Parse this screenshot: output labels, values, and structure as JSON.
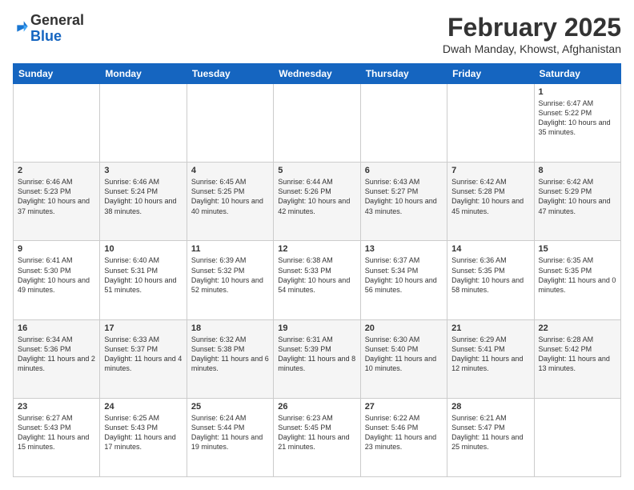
{
  "header": {
    "logo": {
      "general": "General",
      "blue": "Blue"
    },
    "title": "February 2025",
    "location": "Dwah Manday, Khowst, Afghanistan"
  },
  "days": [
    "Sunday",
    "Monday",
    "Tuesday",
    "Wednesday",
    "Thursday",
    "Friday",
    "Saturday"
  ],
  "weeks": [
    [
      {
        "num": "",
        "content": ""
      },
      {
        "num": "",
        "content": ""
      },
      {
        "num": "",
        "content": ""
      },
      {
        "num": "",
        "content": ""
      },
      {
        "num": "",
        "content": ""
      },
      {
        "num": "",
        "content": ""
      },
      {
        "num": "1",
        "content": "Sunrise: 6:47 AM\nSunset: 5:22 PM\nDaylight: 10 hours\nand 35 minutes."
      }
    ],
    [
      {
        "num": "2",
        "content": "Sunrise: 6:46 AM\nSunset: 5:23 PM\nDaylight: 10 hours\nand 37 minutes."
      },
      {
        "num": "3",
        "content": "Sunrise: 6:46 AM\nSunset: 5:24 PM\nDaylight: 10 hours\nand 38 minutes."
      },
      {
        "num": "4",
        "content": "Sunrise: 6:45 AM\nSunset: 5:25 PM\nDaylight: 10 hours\nand 40 minutes."
      },
      {
        "num": "5",
        "content": "Sunrise: 6:44 AM\nSunset: 5:26 PM\nDaylight: 10 hours\nand 42 minutes."
      },
      {
        "num": "6",
        "content": "Sunrise: 6:43 AM\nSunset: 5:27 PM\nDaylight: 10 hours\nand 43 minutes."
      },
      {
        "num": "7",
        "content": "Sunrise: 6:42 AM\nSunset: 5:28 PM\nDaylight: 10 hours\nand 45 minutes."
      },
      {
        "num": "8",
        "content": "Sunrise: 6:42 AM\nSunset: 5:29 PM\nDaylight: 10 hours\nand 47 minutes."
      }
    ],
    [
      {
        "num": "9",
        "content": "Sunrise: 6:41 AM\nSunset: 5:30 PM\nDaylight: 10 hours\nand 49 minutes."
      },
      {
        "num": "10",
        "content": "Sunrise: 6:40 AM\nSunset: 5:31 PM\nDaylight: 10 hours\nand 51 minutes."
      },
      {
        "num": "11",
        "content": "Sunrise: 6:39 AM\nSunset: 5:32 PM\nDaylight: 10 hours\nand 52 minutes."
      },
      {
        "num": "12",
        "content": "Sunrise: 6:38 AM\nSunset: 5:33 PM\nDaylight: 10 hours\nand 54 minutes."
      },
      {
        "num": "13",
        "content": "Sunrise: 6:37 AM\nSunset: 5:34 PM\nDaylight: 10 hours\nand 56 minutes."
      },
      {
        "num": "14",
        "content": "Sunrise: 6:36 AM\nSunset: 5:35 PM\nDaylight: 10 hours\nand 58 minutes."
      },
      {
        "num": "15",
        "content": "Sunrise: 6:35 AM\nSunset: 5:35 PM\nDaylight: 11 hours\nand 0 minutes."
      }
    ],
    [
      {
        "num": "16",
        "content": "Sunrise: 6:34 AM\nSunset: 5:36 PM\nDaylight: 11 hours\nand 2 minutes."
      },
      {
        "num": "17",
        "content": "Sunrise: 6:33 AM\nSunset: 5:37 PM\nDaylight: 11 hours\nand 4 minutes."
      },
      {
        "num": "18",
        "content": "Sunrise: 6:32 AM\nSunset: 5:38 PM\nDaylight: 11 hours\nand 6 minutes."
      },
      {
        "num": "19",
        "content": "Sunrise: 6:31 AM\nSunset: 5:39 PM\nDaylight: 11 hours\nand 8 minutes."
      },
      {
        "num": "20",
        "content": "Sunrise: 6:30 AM\nSunset: 5:40 PM\nDaylight: 11 hours\nand 10 minutes."
      },
      {
        "num": "21",
        "content": "Sunrise: 6:29 AM\nSunset: 5:41 PM\nDaylight: 11 hours\nand 12 minutes."
      },
      {
        "num": "22",
        "content": "Sunrise: 6:28 AM\nSunset: 5:42 PM\nDaylight: 11 hours\nand 13 minutes."
      }
    ],
    [
      {
        "num": "23",
        "content": "Sunrise: 6:27 AM\nSunset: 5:43 PM\nDaylight: 11 hours\nand 15 minutes."
      },
      {
        "num": "24",
        "content": "Sunrise: 6:25 AM\nSunset: 5:43 PM\nDaylight: 11 hours\nand 17 minutes."
      },
      {
        "num": "25",
        "content": "Sunrise: 6:24 AM\nSunset: 5:44 PM\nDaylight: 11 hours\nand 19 minutes."
      },
      {
        "num": "26",
        "content": "Sunrise: 6:23 AM\nSunset: 5:45 PM\nDaylight: 11 hours\nand 21 minutes."
      },
      {
        "num": "27",
        "content": "Sunrise: 6:22 AM\nSunset: 5:46 PM\nDaylight: 11 hours\nand 23 minutes."
      },
      {
        "num": "28",
        "content": "Sunrise: 6:21 AM\nSunset: 5:47 PM\nDaylight: 11 hours\nand 25 minutes."
      },
      {
        "num": "",
        "content": ""
      }
    ]
  ]
}
